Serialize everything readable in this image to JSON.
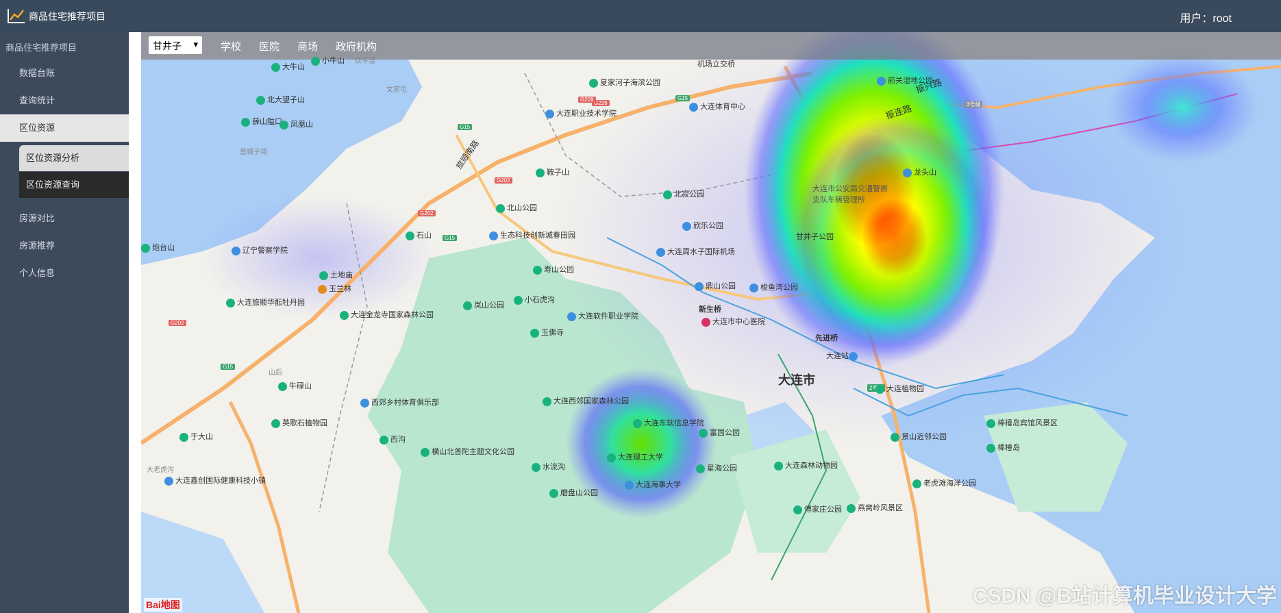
{
  "header": {
    "app_title": "商品住宅推荐项目",
    "user_label": "用户：root",
    "logo_icon": "trend-chart-icon"
  },
  "sidebar": {
    "head": "商品住宅推荐项目",
    "items": [
      {
        "label": "数据台账"
      },
      {
        "label": "查询统计"
      },
      {
        "label": "区位资源"
      },
      {
        "label": "房源对比"
      },
      {
        "label": "房源推荐"
      },
      {
        "label": "个人信息"
      }
    ],
    "subitems": [
      {
        "label": "区位资源分析"
      },
      {
        "label": "区位资源查询"
      }
    ]
  },
  "toolbar": {
    "district_select": "甘井子",
    "links": [
      "学校",
      "医院",
      "商场",
      "政府机构"
    ]
  },
  "map": {
    "pois": [
      "小牛山",
      "大牛山",
      "饮牛洼",
      "文家屯",
      "北大望子山",
      "薛山隘口",
      "凤凰山",
      "营城子湾",
      "夏家河子海滨公园",
      "大连职业技术学院",
      "鞍子山",
      "北山公园",
      "石山",
      "生态科技创新城春田园",
      "辽宁警察学院",
      "炮台山",
      "土地庙",
      "玉兰林",
      "大连旅顺华酝牡丹园",
      "大连金龙寺国家森林公园",
      "岚山公园",
      "小石虎沟",
      "寿山公园",
      "大连软件职业学院",
      "玉佛寺",
      "牛碌山",
      "西郊乡村体育俱乐部",
      "英歌石植物园",
      "于大山",
      "西沟",
      "横山北普陀主题文化公园",
      "大连西郊国家森林公园",
      "大连鑫创国际健康科技小镇",
      "水流沟",
      "大老虎沟",
      "机场立交桥",
      "大连体育中心",
      "前关湿地公园",
      "龙头山",
      "北寂公园",
      "欣乐公园",
      "大连周水子国际机场",
      "甘井子公园",
      "大连市公安局交通警察支队车辆管理所",
      "鼎山公园",
      "梭鱼湾公园",
      "新生桥",
      "大连市中心医院",
      "先进桥",
      "大连站",
      "大连植物园",
      "大连东软信息学院",
      "大连理工大学",
      "富国公园",
      "星海公园",
      "大连海事大学",
      "磨盘山公园",
      "景山近邻公园",
      "大连森林动物园",
      "棒棰岛宾馆风景区",
      "棒棰岛",
      "老虎滩海洋公园",
      "傅家庄公园",
      "燕窝岭风景区",
      "振兴路",
      "振连路",
      "旅顺南路",
      "山后"
    ],
    "roads": [
      "G15",
      "G228",
      "G202",
      "G15",
      "G202",
      "G15",
      "G202",
      "G15",
      "G228",
      "3号线",
      "2号线"
    ],
    "district_label": "大连市",
    "heat_spots": [
      {
        "area": "甘井子北部",
        "intensity": "high"
      },
      {
        "area": "大连东软信息学院周边",
        "intensity": "medium"
      },
      {
        "area": "东北海岸",
        "intensity": "low"
      }
    ],
    "watermark": "CSDN @B站计算机毕业设计大学",
    "baidu_logo": "Bai地图"
  }
}
